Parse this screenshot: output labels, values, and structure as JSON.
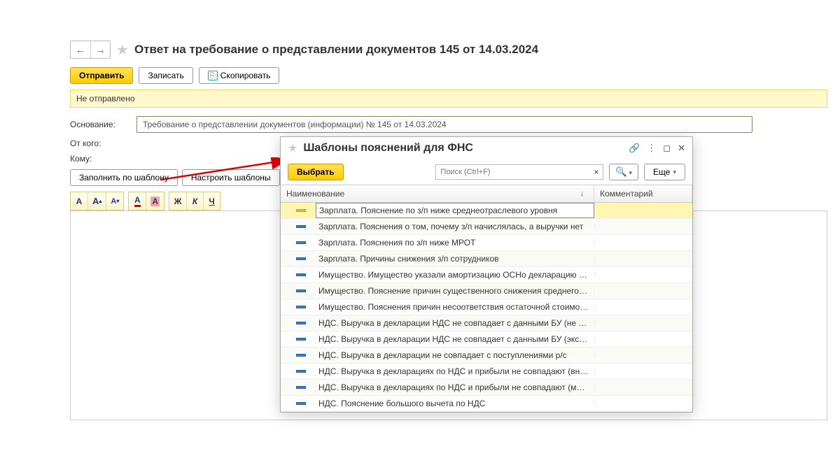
{
  "header": {
    "title": "Ответ на требование о представлении документов  145   от  14.03.2024"
  },
  "toolbar": {
    "send": "Отправить",
    "save": "Записать",
    "copy": "Скопировать"
  },
  "status": "Не отправлено",
  "form": {
    "basis_label": "Основание:",
    "basis_value": "Требование о представлении документов (информации) №  145   от 14.03.2024",
    "from_label": "От кого:",
    "to_label": "Кому:"
  },
  "template_actions": {
    "fill": "Заполнить по шаблону",
    "setup": "Настроить шаблоны"
  },
  "editor_tb": {
    "A": "А",
    "Aplus": "А̂",
    "Aminus": "А̌",
    "Au": "А",
    "Ah": "А",
    "bold": "Ж",
    "italic": "К",
    "underline": "Ч"
  },
  "dialog": {
    "title": "Шаблоны пояснений для ФНС",
    "select": "Выбрать",
    "search_placeholder": "Поиск (Ctrl+F)",
    "more": "Еще",
    "col_name": "Наименование",
    "col_comment": "Комментарий",
    "rows": [
      "Зарплата. Пояснение по з/п ниже среднеотраслевого уровня",
      "Зарплата. Пояснения о том, почему з/п начислялась, а выручки нет",
      "Зарплата. Пояснения по з/п ниже МРОТ",
      "Зарплата. Причины снижения з/п сотрудников",
      "Имущество. Имущество указали амортизацию ОСНо декларацию …",
      "Имущество. Пояснение причин существенного снижения среднего…",
      "Имущество. Пояснения причин несоответствия остаточной стоимо…",
      "НДС. Выручка в декларации НДС не совпадает с данными БУ (не …",
      "НДС. Выручка в декларации НДС не совпадает с данными БУ (экс…",
      "НДС. Выручка в декларации не совпадает с поступлениями р/с",
      "НДС. Выручка в декларациях по НДС и прибыли не совпадают (вн…",
      "НДС. Выручка в декларациях по НДС и прибыли не совпадают (м…",
      "НДС. Пояснение большого вычета по НДС"
    ]
  }
}
